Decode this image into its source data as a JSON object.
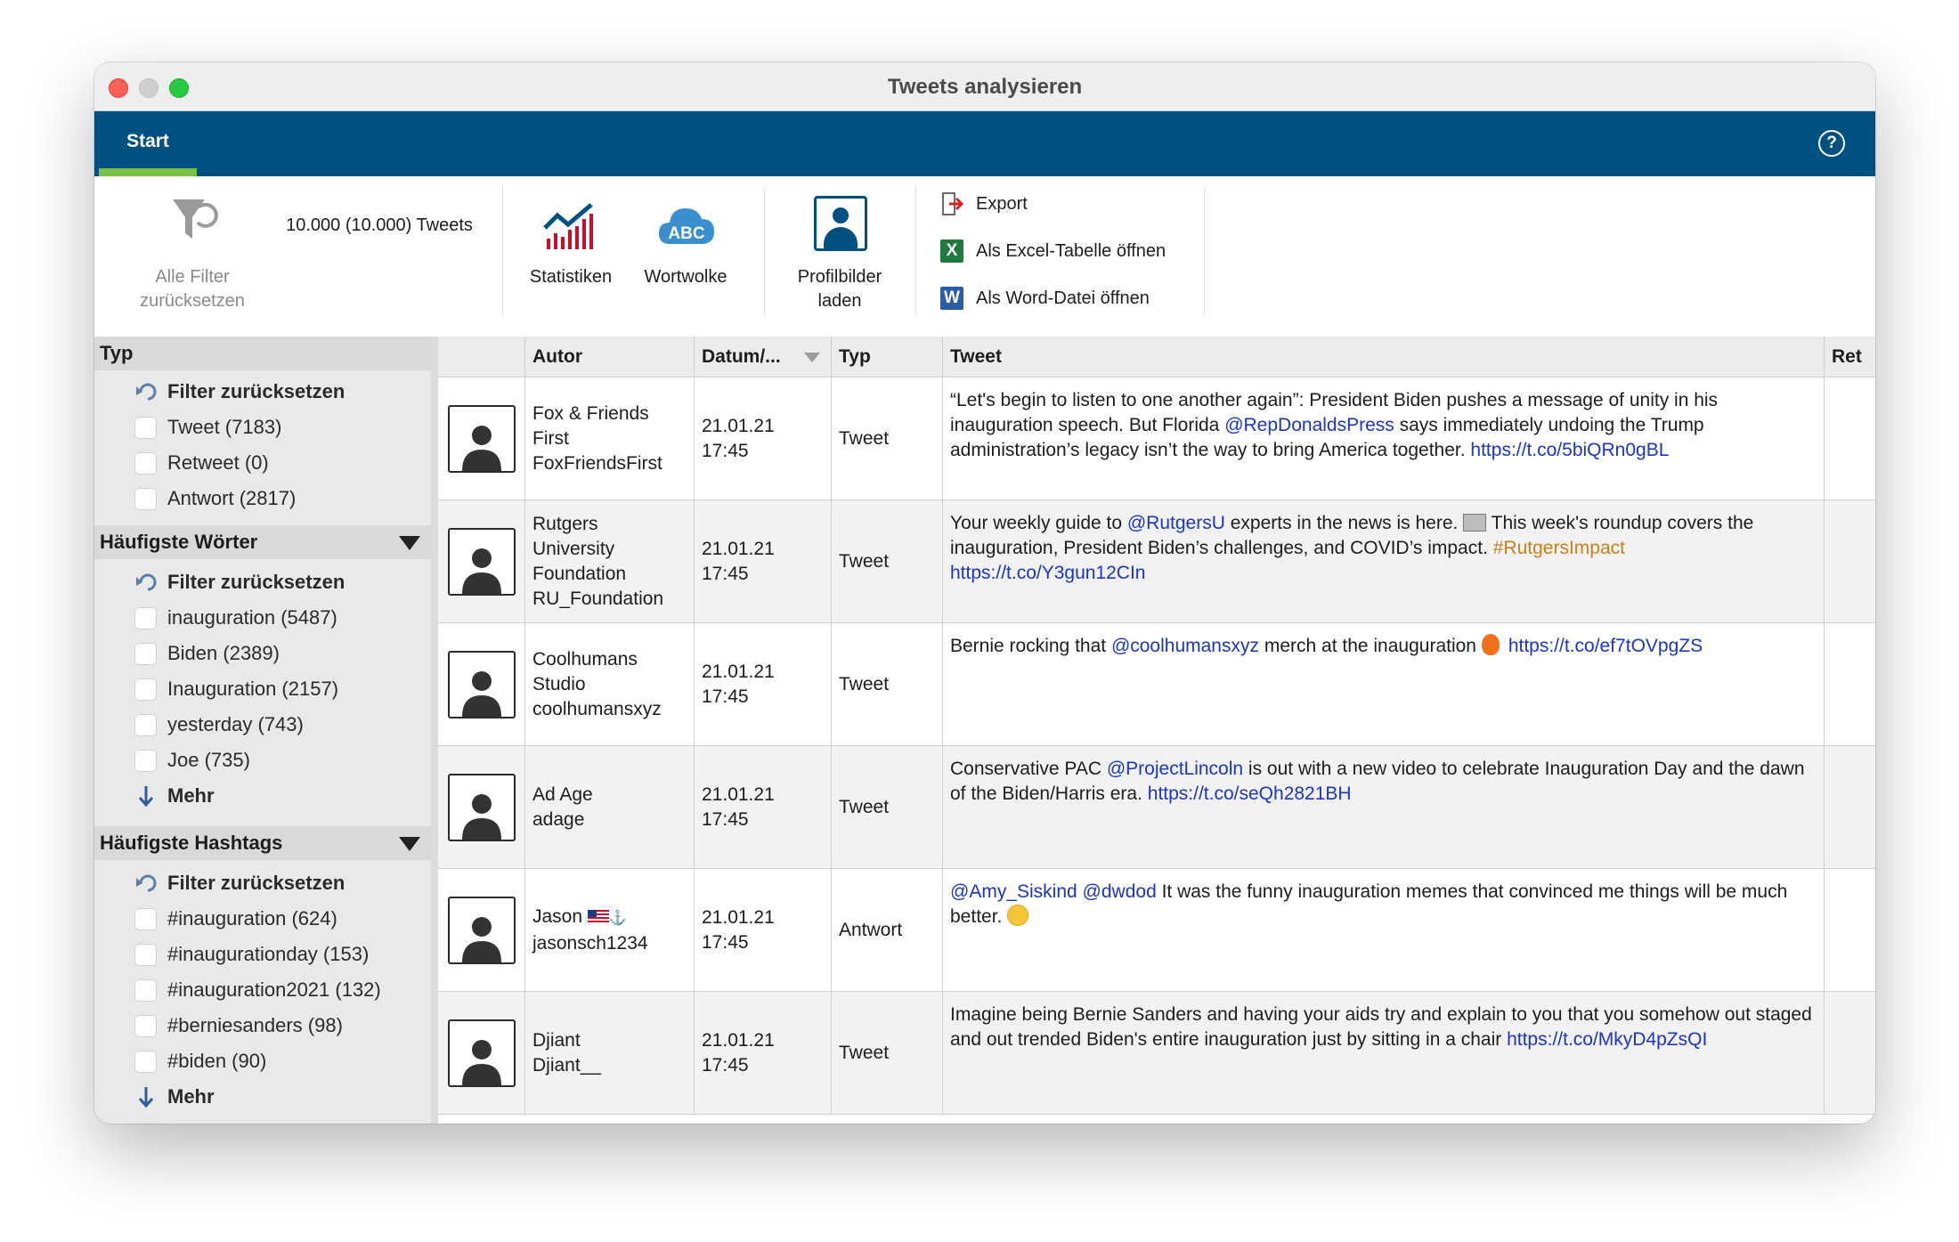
{
  "window": {
    "title": "Tweets analysieren"
  },
  "ribbon": {
    "tab_start": "Start",
    "help_icon": "?"
  },
  "toolbar": {
    "reset_all_line1": "Alle Filter",
    "reset_all_line2": "zurücksetzen",
    "tweet_count": "10.000 (10.000) Tweets",
    "statistics": "Statistiken",
    "wordcloud": "Wortwolke",
    "wordcloud_icon_text": "ABC",
    "profile_line1": "Profilbilder",
    "profile_line2": "laden",
    "export": "Export",
    "excel": "Als Excel-Tabelle öffnen",
    "excel_icon_text": "X",
    "word": "Als Word-Datei öffnen",
    "word_icon_text": "W"
  },
  "sidebar": {
    "typ": {
      "title": "Typ",
      "reset": "Filter zurücksetzen",
      "items": [
        "Tweet (7183)",
        "Retweet (0)",
        "Antwort (2817)"
      ]
    },
    "words": {
      "title": "Häufigste Wörter",
      "reset": "Filter zurücksetzen",
      "items": [
        "inauguration (5487)",
        "Biden (2389)",
        "Inauguration (2157)",
        "yesterday (743)",
        "Joe (735)"
      ],
      "more": "Mehr"
    },
    "hashtags": {
      "title": "Häufigste Hashtags",
      "reset": "Filter zurücksetzen",
      "items": [
        "#inauguration (624)",
        "#inaugurationday (153)",
        "#inauguration2021 (132)",
        "#berniesanders (98)",
        "#biden (90)"
      ],
      "more": "Mehr"
    }
  },
  "table": {
    "columns": [
      "Autor",
      "Datum/...",
      "Typ",
      "Tweet",
      "Ret"
    ],
    "rows": [
      {
        "author_name": [
          "Fox & Friends",
          "First"
        ],
        "author_handle": "FoxFriendsFirst",
        "date": "21.01.21",
        "time": "17:45",
        "type": "Tweet",
        "t1": "“Let's begin to listen to one another again”: President Biden pushes a message of unity in his inauguration speech. But Florida ",
        "l1": "@RepDonaldsPress",
        "t2": " says immediately undoing the Trump administration’s legacy isn’t the way to bring America together. ",
        "l2": "https://t.co/5biQRn0gBL"
      },
      {
        "author_name": [
          "Rutgers",
          "University",
          "Foundation"
        ],
        "author_handle": "RU_Foundation",
        "date": "21.01.21",
        "time": "17:45",
        "type": "Tweet",
        "t1": "Your weekly guide to ",
        "l1": "@RutgersU",
        "t2": " experts in the news is here. ",
        "t3": " This week's roundup covers the inauguration, President Biden’s challenges, and COVID’s impact. ",
        "h1": "#RutgersImpact",
        "l2": "https://t.co/Y3gun12CIn"
      },
      {
        "author_name": [
          "Coolhumans",
          "Studio"
        ],
        "author_handle": "coolhumansxyz",
        "date": "21.01.21",
        "time": "17:45",
        "type": "Tweet",
        "t1": "Bernie rocking that ",
        "l1": "@coolhumansxyz",
        "t2": " merch at the inauguration ",
        "l2": "https://t.co/ef7tOVpgZS"
      },
      {
        "author_name": [
          "Ad Age"
        ],
        "author_handle": "adage",
        "date": "21.01.21",
        "time": "17:45",
        "type": "Tweet",
        "t1": "Conservative PAC ",
        "l1": "@ProjectLincoln",
        "t2": " is out with a new video to celebrate Inauguration Day and the dawn of the Biden/Harris era. ",
        "l2": "https://t.co/seQh2821BH"
      },
      {
        "author_name": [
          "Jason"
        ],
        "author_handle": "jasonsch1234",
        "date": "21.01.21",
        "time": "17:45",
        "type": "Antwort",
        "l1": "@Amy_Siskind",
        "l1b": "@dwdod",
        "t2": " It was the funny inauguration memes that convinced me things will be much better. "
      },
      {
        "author_name": [
          "Djiant"
        ],
        "author_handle": "Djiant__",
        "date": "21.01.21",
        "time": "17:45",
        "type": "Tweet",
        "t1": "Imagine being Bernie Sanders and having your aids try and explain to you that you somehow out staged and out trended Biden's entire inauguration just by sitting in a chair ",
        "l2": "https://t.co/MkyD4pZsQI"
      }
    ]
  },
  "colors": {
    "ribbon": "#005082",
    "tab_underline": "#7ac142",
    "link": "#1a35c8",
    "hashtag": "#c68118"
  }
}
